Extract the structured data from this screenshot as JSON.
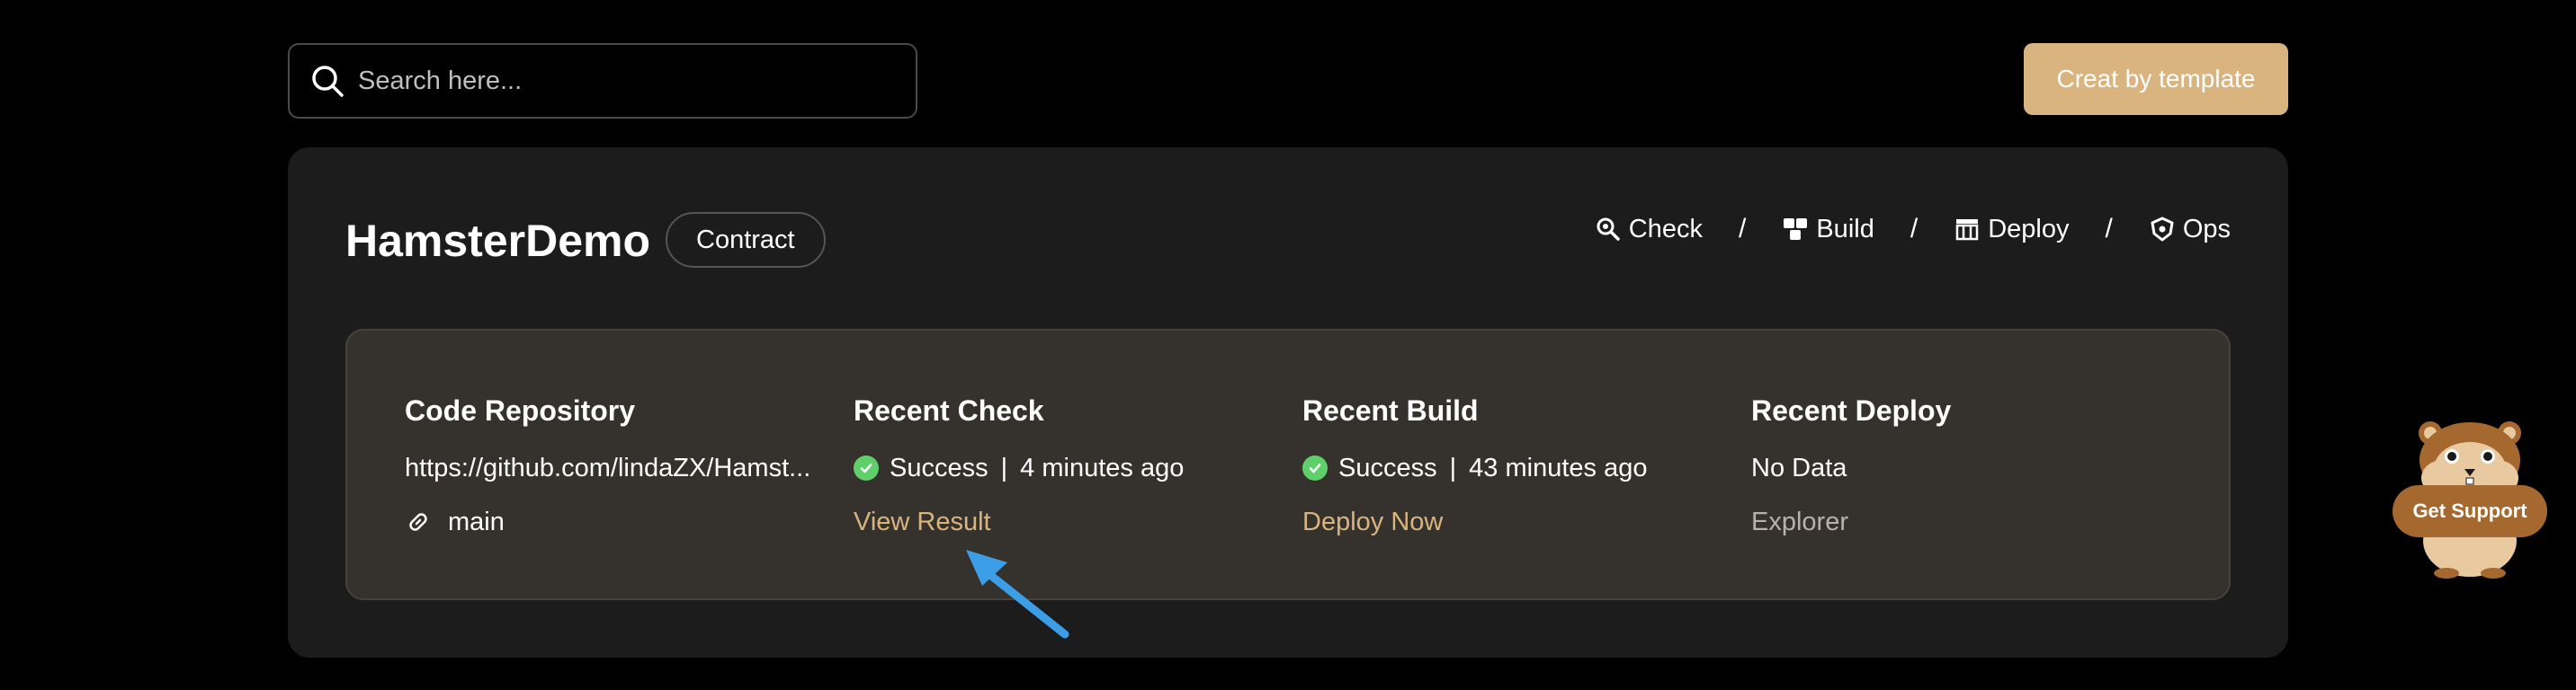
{
  "search": {
    "placeholder": "Search here..."
  },
  "toolbar": {
    "create_template_label": "Creat by template"
  },
  "project": {
    "name": "HamsterDemo",
    "type_tag": "Contract"
  },
  "pipeline": [
    {
      "label": "Check",
      "icon": "magnifier-icon"
    },
    {
      "label": "Build",
      "icon": "cubes-icon"
    },
    {
      "label": "Deploy",
      "icon": "deploy-icon"
    },
    {
      "label": "Ops",
      "icon": "shield-icon"
    }
  ],
  "pipeline_separator": "/",
  "summary": {
    "repository": {
      "title": "Code Repository",
      "url": "https://github.com/lindaZX/Hamst...",
      "branch": "main"
    },
    "check": {
      "title": "Recent Check",
      "status": "Success",
      "time": "4 minutes ago",
      "action": "View Result"
    },
    "build": {
      "title": "Recent Build",
      "status": "Success",
      "time": "43 minutes ago",
      "action": "Deploy Now"
    },
    "deploy": {
      "title": "Recent Deploy",
      "status": "No Data",
      "action": "Explorer"
    },
    "separator": "|"
  },
  "support": {
    "label": "Get Support"
  },
  "colors": {
    "accent": "#d9b47f",
    "success": "#5fcf6a",
    "panel": "#1c1c1c",
    "card": "#35322d",
    "annotation_arrow": "#3d9ee8"
  }
}
